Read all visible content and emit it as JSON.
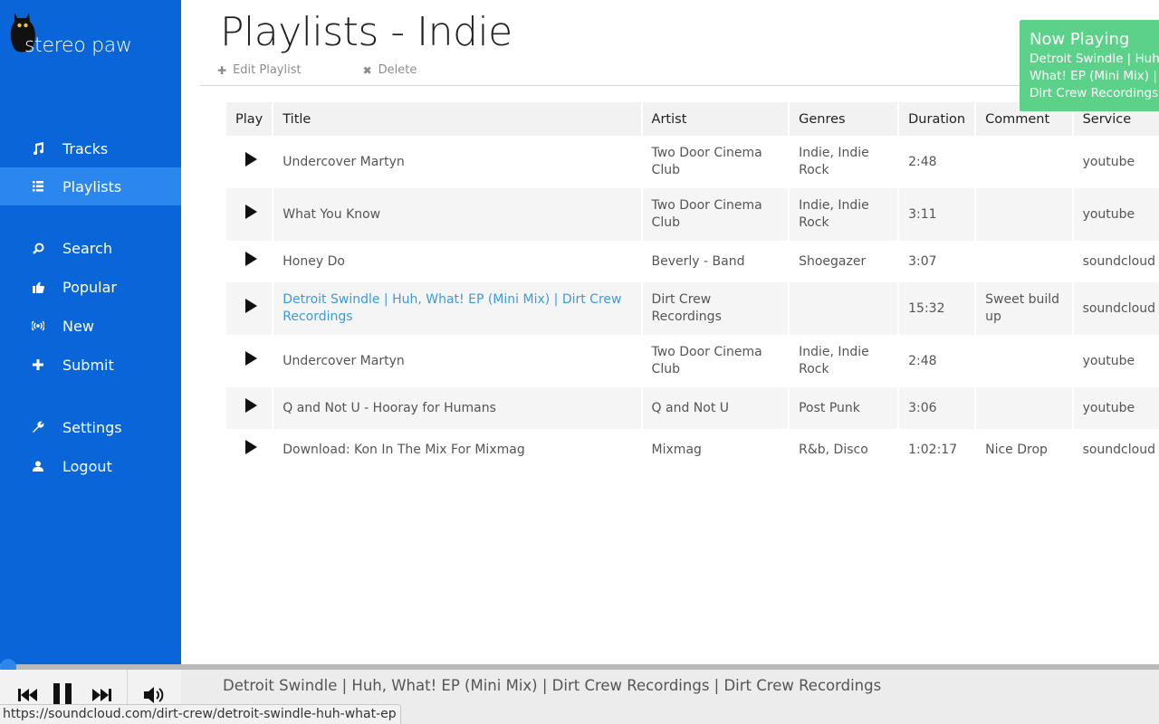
{
  "brand": {
    "name": "stereo paw",
    "logo_icon": "cat-icon"
  },
  "sidebar": {
    "items": [
      {
        "label": "Tracks",
        "icon": "music-icon"
      },
      {
        "label": "Playlists",
        "icon": "list-icon",
        "active": true
      },
      {
        "label": "Search",
        "icon": "search-icon"
      },
      {
        "label": "Popular",
        "icon": "thumbs-up-icon"
      },
      {
        "label": "New",
        "icon": "broadcast-icon"
      },
      {
        "label": "Submit",
        "icon": "plus-icon"
      },
      {
        "label": "Settings",
        "icon": "wrench-icon"
      },
      {
        "label": "Logout",
        "icon": "user-icon"
      }
    ]
  },
  "header": {
    "title": "Playlists - Indie",
    "edit_label": "Edit Playlist",
    "delete_label": "Delete"
  },
  "now_playing": {
    "title": "Now Playing",
    "track": "Detroit Swindle | Huh, What! EP (Mini Mix) | Dirt Crew Recordings"
  },
  "table": {
    "columns": [
      "Play",
      "Title",
      "Artist",
      "Genres",
      "Duration",
      "Comment",
      "Service"
    ],
    "rows": [
      {
        "title": "Undercover Martyn",
        "artist": "Two Door Cinema Club",
        "genres": "Indie, Indie Rock",
        "duration": "2:48",
        "comment": "",
        "service": "youtube"
      },
      {
        "title": "What You Know",
        "artist": "Two Door Cinema Club",
        "genres": "Indie, Indie Rock",
        "duration": "3:11",
        "comment": "",
        "service": "youtube"
      },
      {
        "title": "Honey Do",
        "artist": "Beverly - Band",
        "genres": "Shoegazer",
        "duration": "3:07",
        "comment": "",
        "service": "soundcloud"
      },
      {
        "title": "Detroit Swindle | Huh, What! EP (Mini Mix) | Dirt Crew Recordings",
        "artist": "Dirt Crew Recordings",
        "genres": "",
        "duration": "15:32",
        "comment": "Sweet build up",
        "service": "soundcloud",
        "playing": true
      },
      {
        "title": "Undercover Martyn",
        "artist": "Two Door Cinema Club",
        "genres": "Indie, Indie Rock",
        "duration": "2:48",
        "comment": "",
        "service": "youtube"
      },
      {
        "title": "Q and Not U - Hooray for Humans",
        "artist": "Q and Not U",
        "genres": "Post Punk",
        "duration": "3:06",
        "comment": "",
        "service": "youtube"
      },
      {
        "title": "Download: Kon In The Mix For Mixmag",
        "artist": "Mixmag",
        "genres": "R&b, Disco",
        "duration": "1:02:17",
        "comment": "Nice Drop",
        "service": "soundcloud"
      }
    ]
  },
  "player": {
    "track": "Detroit Swindle | Huh, What! EP (Mini Mix) | Dirt Crew Recordings | Dirt Crew Recordings",
    "progress": 0.0,
    "controls": [
      "previous-icon",
      "pause-icon",
      "next-icon",
      "volume-icon"
    ]
  },
  "status_bar": {
    "url": "https://soundcloud.com/dirt-crew/detroit-swindle-huh-what-ep"
  },
  "colors": {
    "sidebar": "#0a66d8",
    "active": "#2b86ee",
    "toast": "#5cd18a",
    "playing_link": "#3d9ad8"
  }
}
